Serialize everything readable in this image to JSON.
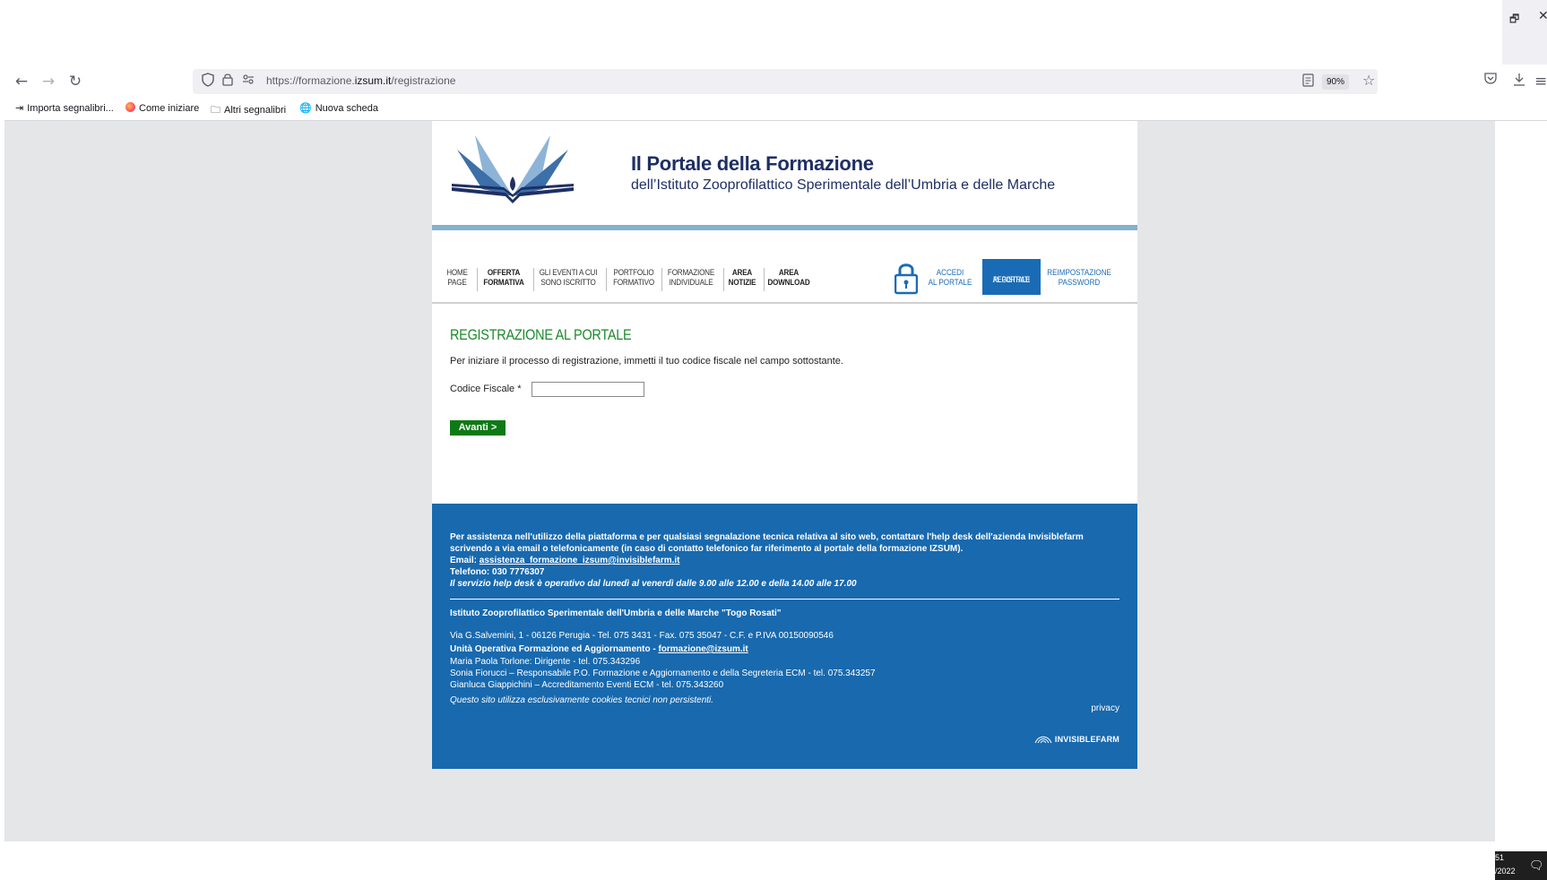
{
  "browser": {
    "url_prefix": "https://formazione.",
    "url_domain": "izsum.it",
    "url_path": "/registrazione",
    "zoom": "90%",
    "icons": {
      "back": "arrow-left-icon",
      "forward": "arrow-right-icon",
      "reload": "reload-icon",
      "shield": "shield-icon",
      "lock": "lock-icon",
      "permissions": "permissions-icon",
      "reader": "reader-view-icon",
      "bookmark": "star-icon",
      "pocket": "pocket-icon",
      "download": "download-icon",
      "menu": "hamburger-menu-icon"
    }
  },
  "window": {
    "restore": "🗗",
    "close": "✕"
  },
  "bookmarks": [
    {
      "label": "Importa segnalibri...",
      "icon": "import-icon"
    },
    {
      "label": "Come iniziare",
      "icon": "firefox-icon"
    },
    {
      "label": "Altri segnalibri",
      "icon": "folder-icon"
    },
    {
      "label": "Nuova scheda",
      "icon": "globe-icon"
    }
  ],
  "site": {
    "title": "Il Portale della Formazione",
    "subtitle": "dell’Istituto Zooprofilattico Sperimentale dell’Umbria e delle Marche",
    "menu": [
      {
        "line1": "HOME",
        "line2": "PAGE"
      },
      {
        "line1": "OFFERTA",
        "line2": "FORMATIVA"
      },
      {
        "line1": "GLI EVENTI A CUI",
        "line2": "SONO ISCRITTO"
      },
      {
        "line1": "PORTFOLIO",
        "line2": "FORMATIVO"
      },
      {
        "line1": "FORMAZIONE",
        "line2": "INDIVIDUALE"
      },
      {
        "line1": "AREA",
        "line2": "NOTIZIE"
      },
      {
        "line1": "AREA",
        "line2": "DOWNLOAD"
      }
    ],
    "menu_right": {
      "login_line1": "ACCEDI",
      "login_line2": "AL PORTALE",
      "register_line1": "REGISTRATI",
      "register_line2": "AL PORTALE",
      "reset_line1": "REIMPOSTAZIONE",
      "reset_line2": "PASSWORD"
    },
    "colors": {
      "primary_blue": "#1869ae",
      "accent_green": "#1d8a2b",
      "button_green": "#0e7a16",
      "header_bar": "#82b2cd",
      "title_navy": "#1e2f63"
    }
  },
  "form": {
    "heading": "REGISTRAZIONE AL PORTALE",
    "intro": "Per iniziare il processo di registrazione, immetti il tuo codice fiscale nel campo sottostante.",
    "field_label": "Codice Fiscale *",
    "field_value": "",
    "submit_label": "Avanti >"
  },
  "footer": {
    "assist_line1": "Per assistenza nell'utilizzo della piattaforma e per qualsiasi segnalazione tecnica relativa al sito web, contattare l'help desk dell'azienda Invisiblefarm",
    "assist_line2": "scrivendo a via email o telefonicamente (in caso di contatto telefonico far riferimento al portale della formazione IZSUM).",
    "email_label": "Email: ",
    "email": "assistenza_formazione_izsum@invisiblefarm.it",
    "phone": "Telefono: 030 7776307",
    "hours": "Il servizio help desk è operativo dal lunedì al venerdì dalle 9.00 alle 12.00 e della 14.00 alle 17.00",
    "institute": "Istituto Zooprofilattico Sperimentale dell'Umbria e delle Marche \"Togo Rosati\"",
    "address": "Via G.Salvemini, 1 - 06126 Perugia - Tel. 075 3431 - Fax. 075 35047 - C.F. e P.IVA 00150090546",
    "unit_label": "Unità Operativa Formazione ed Aggiornamento - ",
    "unit_email": "formazione@izsum.it",
    "staff1": "Maria Paola Torlone: Dirigente - tel. 075.343296",
    "staff2": "Sonia Fiorucci – Responsabile P.O. Formazione e Aggiornamento e della Segreteria ECM - tel. 075.343257",
    "staff3": "Gianluca Giappichini – Accreditamento Eventi ECM - tel. 075.343260",
    "cookies": "Questo sito utilizza esclusivamente cookies tecnici non persistenti.",
    "privacy": "privacy",
    "brand": "INVISIBLEFARM"
  },
  "taskbar": {
    "time_fragment": "51",
    "date_fragment": "/2022"
  }
}
